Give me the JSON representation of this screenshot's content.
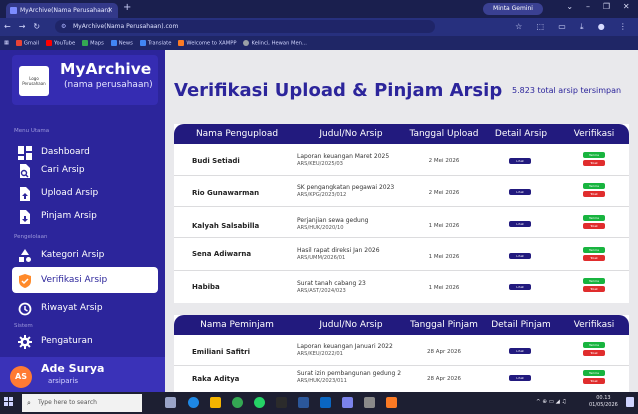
{
  "browser": {
    "tab_title": "MyArchive(Nama Perusahaan)",
    "tab_close": "×",
    "new_tab": "+",
    "gemini_label": "Minta Gemini",
    "url": "MyArchive(Nama Perusahaan).com",
    "bookmarks": [
      {
        "label": "Gmail",
        "color": "#ea4335"
      },
      {
        "label": "YouTube",
        "color": "#ff0000"
      },
      {
        "label": "Maps",
        "color": "#34a853"
      },
      {
        "label": "News",
        "color": "#4285f4"
      },
      {
        "label": "Translate",
        "color": "#4285f4"
      },
      {
        "label": "Welcome to XAMPP",
        "color": "#fb7a24"
      },
      {
        "label": "Kelinci, Hewan Men...",
        "color": "#9aa0a6"
      }
    ]
  },
  "sidebar": {
    "logo_text": "Logo Perusahaan",
    "app_name": "MyArchive",
    "app_subtitle": "(nama perusahaan)",
    "section_main": "Menu Utama",
    "section_manage": "Pengelolaan",
    "section_system": "Sistem",
    "items": [
      {
        "label": "Dashboard",
        "icon": "dashboard-icon"
      },
      {
        "label": "Cari Arsip",
        "icon": "file-search-icon"
      },
      {
        "label": "Upload Arsip",
        "icon": "file-upload-icon"
      },
      {
        "label": "Pinjam Arsip",
        "icon": "file-borrow-icon"
      },
      {
        "label": "Kategori Arsip",
        "icon": "shapes-icon"
      },
      {
        "label": "Verifikasi Arsip",
        "icon": "shield-check-icon",
        "active": true
      },
      {
        "label": "Riwayat Arsip",
        "icon": "history-icon"
      },
      {
        "label": "Pengaturan",
        "icon": "gear-icon"
      }
    ],
    "profile": {
      "initials": "AS",
      "name": "Ade Surya",
      "role": "arsiparis"
    }
  },
  "main": {
    "title": "Verifikasi Upload & Pinjam Arsip",
    "total": "5.823 total arsip tersimpan",
    "upload_table": {
      "headers": [
        "Nama Pengupload",
        "Judul/No Arsip",
        "Tanggal Upload",
        "Detail Arsip",
        "Verifikasi"
      ],
      "rows": [
        {
          "name": "Budi Setiadi",
          "title": "Laporan keuangan Maret 2025",
          "code": "ARS/KEU/2025/03",
          "date": "2 Mei 2026"
        },
        {
          "name": "Rio Gunawarman",
          "title": "SK pengangkatan pegawai 2023",
          "code": "ARS/KPG/2023/012",
          "date": "2 Mei 2026"
        },
        {
          "name": "Kalyah Salsabilla",
          "title": "Perjanjian sewa gedung",
          "code": "ARS/HUK/2020/10",
          "date": "1 Mei 2026"
        },
        {
          "name": "Sena Adiwarna",
          "title": "Hasil rapat direksi Jan 2026",
          "code": "ARS/UMM/2026/01",
          "date": "1 Mei 2026"
        },
        {
          "name": "Habiba",
          "title": "Surat tanah cabang 23",
          "code": "ARS/AST/2024/023",
          "date": "1 Mei 2026"
        }
      ]
    },
    "borrow_table": {
      "headers": [
        "Nama Peminjam",
        "Judul/No Arsip",
        "Tanggal Pinjam",
        "Detail Pinjam",
        "Verifikasi"
      ],
      "rows": [
        {
          "name": "Emiliani Safitri",
          "title": "Laporan keuangan Januari 2022",
          "code": "ARS/KEU/2022/01",
          "date": "28 Apr 2026"
        },
        {
          "name": "Raka Aditya",
          "title": "Surat izin pembangunan gedung 2",
          "code": "ARS/HUK/2023/011",
          "date": "28 Apr 2026"
        }
      ]
    },
    "detail_label": "Lihat",
    "accept_label": "Terima",
    "reject_label": "Tolak"
  },
  "taskbar": {
    "search_placeholder": "Type here to search",
    "time": "00.13",
    "date": "01/05/2026"
  },
  "colors": {
    "accent": "#2c259b",
    "header": "#221a7e",
    "accept": "#18b43f",
    "reject": "#e02d2d",
    "avatar": "#ff7a33"
  }
}
